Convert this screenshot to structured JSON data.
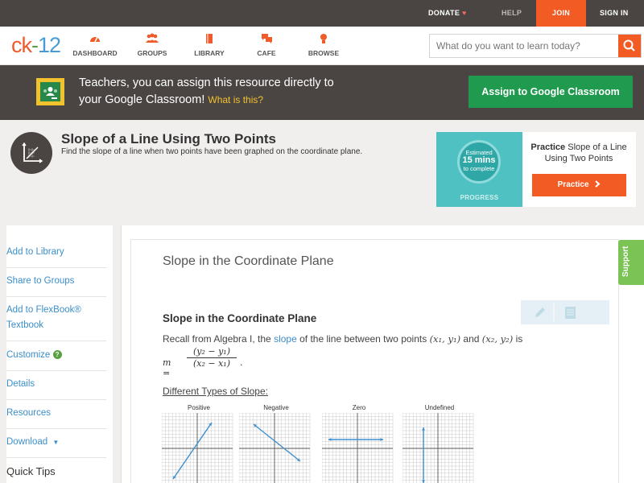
{
  "topbar": {
    "donate": "DONATE",
    "help": "HELP",
    "join": "JOIN",
    "signin": "SIGN IN"
  },
  "nav": {
    "logo_ck": "ck",
    "logo_dash": "-",
    "logo_num": "12",
    "items": [
      {
        "label": "DASHBOARD",
        "icon": "dashboard-icon"
      },
      {
        "label": "GROUPS",
        "icon": "groups-icon"
      },
      {
        "label": "LIBRARY",
        "icon": "library-icon"
      },
      {
        "label": "CAFE",
        "icon": "cafe-icon"
      },
      {
        "label": "BROWSE",
        "icon": "browse-icon"
      }
    ],
    "search_placeholder": "What do you want to learn today?"
  },
  "banner": {
    "line1": "Teachers, you can assign this resource directly to",
    "line2": "your Google Classroom!",
    "whatis": "What is this?",
    "assign_button": "Assign to Google Classroom"
  },
  "concept": {
    "title": "Slope of a Line Using Two Points",
    "subtitle": "Find the slope of a line when two points have been graphed on the coordinate plane."
  },
  "practice": {
    "estimated": "Estimated",
    "minutes": "15 mins",
    "to_complete": "to complete",
    "progress": "PROGRESS",
    "title_bold": "Practice",
    "title_rest": "Slope of a Line Using Two Points",
    "button": "Practice"
  },
  "sidebar": {
    "items": [
      "Add to Library",
      "Share to Groups",
      "Add to FlexBook®",
      "Textbook",
      "Customize",
      "Details",
      "Resources",
      "Download",
      "Quick Tips"
    ]
  },
  "article": {
    "section_title": "Slope in the Coordinate Plane",
    "heading": "Slope in the Coordinate Plane",
    "p_start": "Recall from Algebra I, the",
    "p_link": "slope",
    "p_mid": "of the line between two points",
    "p1": "(x₁, y₁)",
    "p_and": "and",
    "p2": "(x₂, y₂)",
    "p_is": "is",
    "formula_m": "m =",
    "formula_num": "(y₂ − y₁)",
    "formula_den": "(x₂ − x₁)",
    "formula_end": ".",
    "types_label": "Different Types of Slope:",
    "graphs": [
      "Positive",
      "Negative",
      "Zero",
      "Undefined"
    ]
  },
  "support": "Support",
  "colors": {
    "brand_orange": "#f35b25",
    "classroom_green": "#1f9a4e",
    "link_blue": "#3b8ec9",
    "dark_bar": "#4a4543"
  }
}
